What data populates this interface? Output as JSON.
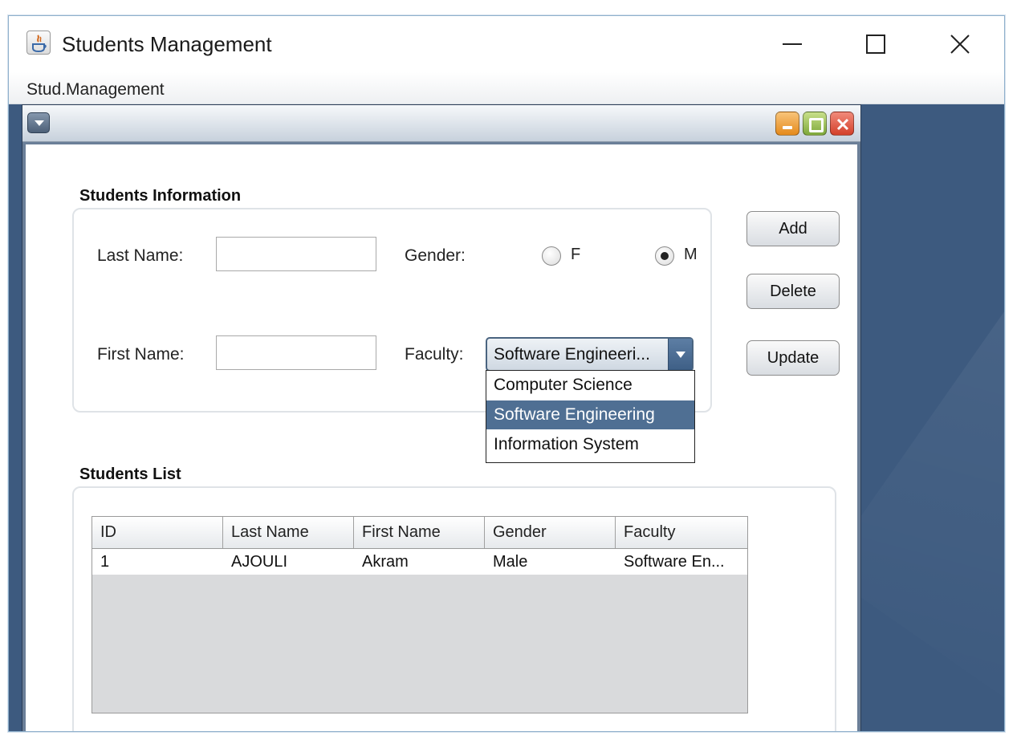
{
  "window": {
    "title": "Students Management",
    "icon": "java-icon"
  },
  "menubar": {
    "items": [
      "Stud.Management"
    ]
  },
  "form": {
    "section_title": "Students Information",
    "last_name_label": "Last Name:",
    "last_name_value": "",
    "first_name_label": "First Name:",
    "first_name_value": "",
    "gender_label": "Gender:",
    "gender_options": [
      "F",
      "M"
    ],
    "gender_selected": "M",
    "faculty_label": "Faculty:",
    "faculty_selected_display": "Software Engineeri...",
    "faculty_options": [
      "Computer Science",
      "Software Engineering",
      "Information System"
    ],
    "faculty_highlighted": "Software Engineering"
  },
  "buttons": {
    "add": "Add",
    "delete": "Delete",
    "update": "Update"
  },
  "list": {
    "section_title": "Students List",
    "columns": [
      "ID",
      "Last Name",
      "First Name",
      "Gender",
      "Faculty"
    ],
    "rows": [
      [
        "1",
        "AJOULI",
        "Akram",
        "Male",
        "Software En..."
      ]
    ]
  },
  "colors": {
    "desktop": "#3d5a7f",
    "selection": "#4f6f93",
    "accent": "#4a6480"
  }
}
